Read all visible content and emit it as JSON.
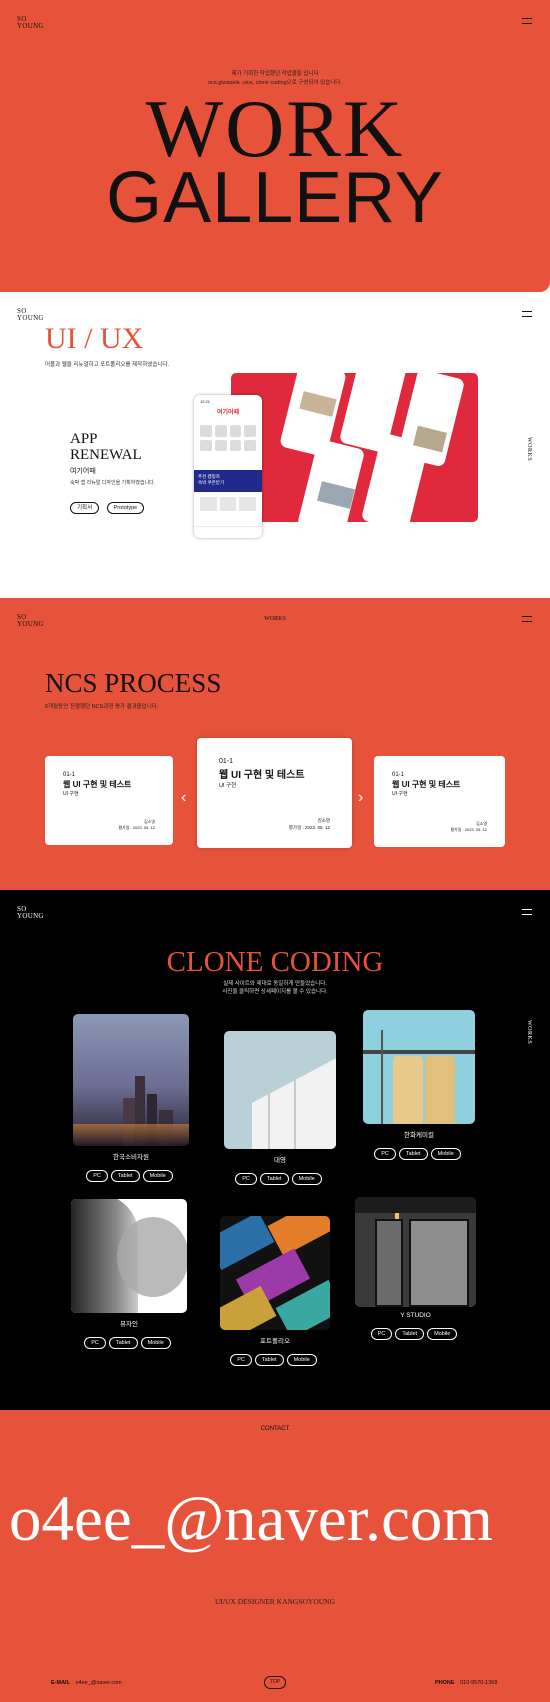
{
  "brand": {
    "logo_line1": "SO",
    "logo_line2": "YOUNG"
  },
  "hero": {
    "intro1": "제가 기획한 작업했던 작업물들 입니다",
    "intro2": "ncs,giwasela ,uiux, clone coding으로 구성되어 있습니다.",
    "title1": "WORK",
    "title2": "GALLERY"
  },
  "uiux": {
    "heading": "UI / UX",
    "desc": "어플과 웹을 리뉴얼하고 포트폴리오를 제작하였습니다.",
    "project_title1": "APP",
    "project_title2": "RENEWAL",
    "project_name": "여기어때",
    "project_desc": "숙박 앱 리뉴얼 디자인을 기획하였습니다.",
    "tags": [
      "기획서",
      "Prototype"
    ],
    "side_label": "WORKS",
    "phone_brand": "여기어때",
    "phone_time": "12:21",
    "phone_banner1": "추천 캠핑카",
    "phone_banner2": "숙박 쿠폰받기"
  },
  "ncs": {
    "nav_label": "WORKS",
    "heading": "NCS PROCESS",
    "desc": "6개월동안 진행했던 NCS과정 평가 결과물입니다.",
    "cards": [
      {
        "num": "01-1",
        "title": "웹 UI 구현 및 테스트",
        "sub": "UI 구현",
        "author": "김소영",
        "date": "평가일 : 2023. 05. 12"
      },
      {
        "num": "01-1",
        "title": "웹 UI 구현 및 테스트",
        "sub": "UI 구현",
        "author": "김소영",
        "date": "평가일 : 2023. 05. 12"
      },
      {
        "num": "01-1",
        "title": "웹 UI 구현 및 테스트",
        "sub": "UI 구현",
        "author": "김소영",
        "date": "평가일 : 2023. 05. 12"
      }
    ],
    "prev_icon": "‹",
    "next_icon": "›"
  },
  "clone": {
    "heading": "CLONE CODING",
    "desc1": "실제 사이트와 제대로 동일하게 만들었습니다.",
    "desc2": "사진을 클릭하면 상세페이지를 볼 수 있습니다.",
    "side_label": "WORKS",
    "items": [
      {
        "name": "한국소비자원",
        "tags": [
          "PC",
          "Tablet",
          "Mobile"
        ]
      },
      {
        "name": "대영",
        "tags": [
          "PC",
          "Tablet",
          "Mobile"
        ]
      },
      {
        "name": "한화케미컬",
        "tags": [
          "PC",
          "Tablet",
          "Mobile"
        ]
      },
      {
        "name": "뮤자인",
        "tags": [
          "PC",
          "Tablet",
          "Mobile"
        ]
      },
      {
        "name": "포트폴리오",
        "tags": [
          "PC",
          "Tablet",
          "Mobile"
        ]
      },
      {
        "name": "Y STUDIO",
        "tags": [
          "PC",
          "Tablet",
          "Mobile"
        ]
      }
    ]
  },
  "contact": {
    "label": "CONTACT",
    "email_big": "o4ee_@naver.com",
    "designer": "UI/UX DESIGNER KANGSOYOUNG",
    "email_label": "E-MAIL",
    "email": "o4ee_@naver.com",
    "top_label": "TOP",
    "phone_label": "PHONE",
    "phone": "010-9570-1368"
  },
  "colors": {
    "accent": "#e7533a",
    "dark": "#000000"
  }
}
